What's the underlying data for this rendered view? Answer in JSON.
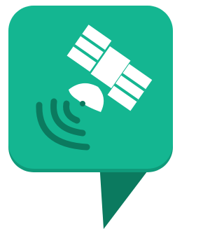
{
  "icon": {
    "name": "satellite-pin-icon",
    "colors": {
      "bubble": "#14b691",
      "pointer": "#0b7a5f",
      "bubble_shadow": "#0f9a7a",
      "satellite": "#ffffff",
      "signal_waves": "#0b7a5f"
    }
  }
}
